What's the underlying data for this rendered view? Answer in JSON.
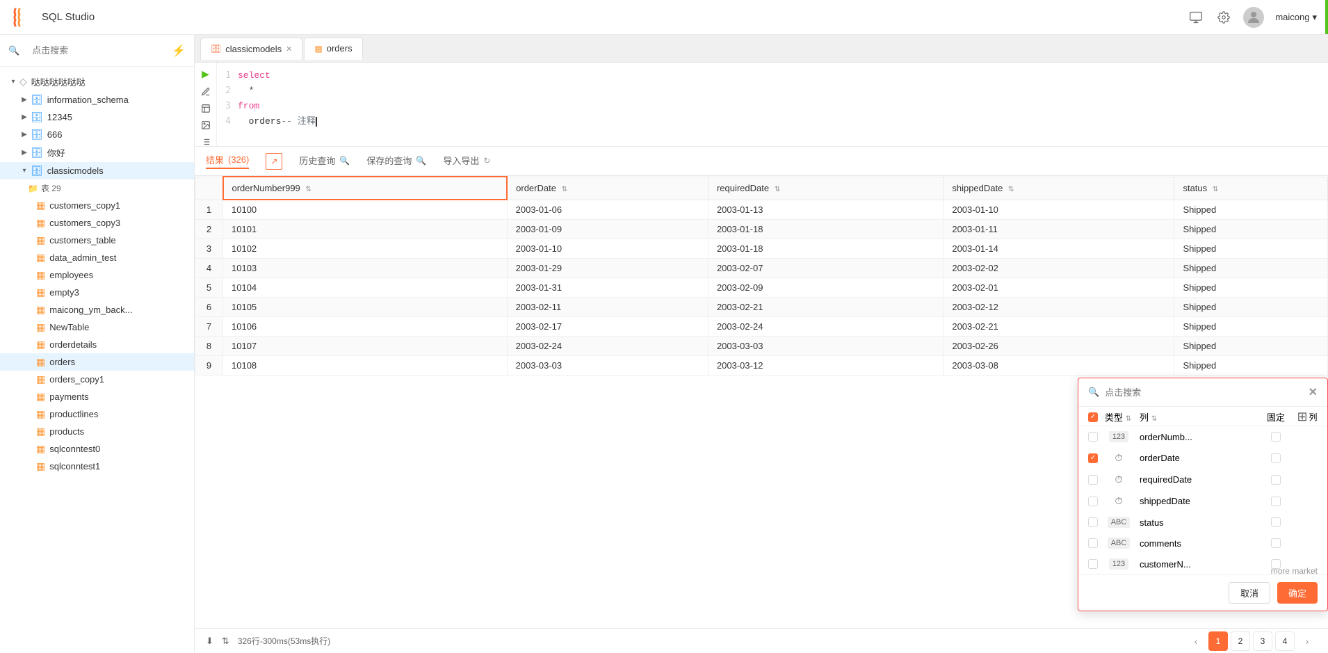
{
  "app": {
    "title": "SQL Studio",
    "username": "maicong"
  },
  "sidebar": {
    "search_placeholder": "点击搜索",
    "root_label": "哒哒哒哒哒哒",
    "databases": [
      {
        "name": "information_schema"
      },
      {
        "name": "12345"
      },
      {
        "name": "666"
      },
      {
        "name": "你好"
      },
      {
        "name": "classicmodels",
        "expanded": true
      }
    ],
    "table_group": "表 29",
    "tables": [
      "customers_copy1",
      "customers_copy3",
      "customers_table",
      "data_admin_test",
      "employees",
      "empty3",
      "maicong_ym_back...",
      "NewTable",
      "orderdetails",
      "orders",
      "orders_copy1",
      "payments",
      "productlines",
      "products",
      "sqlconntest0",
      "sqlconntest1"
    ]
  },
  "tabs": [
    {
      "label": "classicmodels",
      "type": "db",
      "closable": true
    },
    {
      "label": "orders",
      "type": "table",
      "closable": false,
      "active": true
    }
  ],
  "editor": {
    "lines": [
      {
        "num": 1,
        "code": "select",
        "type": "keyword"
      },
      {
        "num": 2,
        "code": "*",
        "type": "normal"
      },
      {
        "num": 3,
        "code": "from",
        "type": "keyword"
      },
      {
        "num": 4,
        "code": "orders -- 注释",
        "type": "mixed"
      }
    ]
  },
  "result_tabs": [
    {
      "label": "结果",
      "count": "(326)",
      "active": true
    },
    {
      "label": "历史查询",
      "active": false
    },
    {
      "label": "保存的查询",
      "active": false
    },
    {
      "label": "导入导出",
      "active": false
    }
  ],
  "table": {
    "columns": [
      {
        "name": "orderNumber999",
        "highlighted": true
      },
      {
        "name": "orderDate"
      },
      {
        "name": "requiredDate"
      },
      {
        "name": "shippedDate"
      },
      {
        "name": "status"
      }
    ],
    "rows": [
      {
        "num": 1,
        "orderNumber": "10100",
        "orderDate": "2003-01-06",
        "requiredDate": "2003-01-13",
        "shippedDate": "2003-01-10",
        "status": "Shipped"
      },
      {
        "num": 2,
        "orderNumber": "10101",
        "orderDate": "2003-01-09",
        "requiredDate": "2003-01-18",
        "shippedDate": "2003-01-11",
        "status": "Shipped"
      },
      {
        "num": 3,
        "orderNumber": "10102",
        "orderDate": "2003-01-10",
        "requiredDate": "2003-01-18",
        "shippedDate": "2003-01-14",
        "status": "Shipped"
      },
      {
        "num": 4,
        "orderNumber": "10103",
        "orderDate": "2003-01-29",
        "requiredDate": "2003-02-07",
        "shippedDate": "2003-02-02",
        "status": "Shipped"
      },
      {
        "num": 5,
        "orderNumber": "10104",
        "orderDate": "2003-01-31",
        "requiredDate": "2003-02-09",
        "shippedDate": "2003-02-01",
        "status": "Shipped"
      },
      {
        "num": 6,
        "orderNumber": "10105",
        "orderDate": "2003-02-11",
        "requiredDate": "2003-02-21",
        "shippedDate": "2003-02-12",
        "status": "Shipped"
      },
      {
        "num": 7,
        "orderNumber": "10106",
        "orderDate": "2003-02-17",
        "requiredDate": "2003-02-24",
        "shippedDate": "2003-02-21",
        "status": "Shipped"
      },
      {
        "num": 8,
        "orderNumber": "10107",
        "orderDate": "2003-02-24",
        "requiredDate": "2003-03-03",
        "shippedDate": "2003-02-26",
        "status": "Shipped"
      },
      {
        "num": 9,
        "orderNumber": "10108",
        "orderDate": "2003-03-03",
        "requiredDate": "2003-03-12",
        "shippedDate": "2003-03-08",
        "status": "Shipped"
      }
    ]
  },
  "bottom": {
    "download_icon": "⬇",
    "sort_icon": "⇅",
    "stats": "326行-300ms(53ms执行)",
    "pages": [
      "1",
      "2",
      "3",
      "4"
    ]
  },
  "column_selector": {
    "search_placeholder": "点击搜索",
    "close_label": "✕",
    "header_labels": {
      "type": "类型",
      "column": "列",
      "pin": "固定",
      "toggle": "列"
    },
    "columns": [
      {
        "type": "123",
        "name": "orderNumb...",
        "checked": false,
        "pinned": false
      },
      {
        "type": "clock",
        "name": "orderDate",
        "checked": true,
        "pinned": false
      },
      {
        "type": "clock",
        "name": "requiredDate",
        "checked": false,
        "pinned": false
      },
      {
        "type": "clock",
        "name": "shippedDate",
        "checked": false,
        "pinned": false
      },
      {
        "type": "ABC",
        "name": "status",
        "checked": false,
        "pinned": false
      },
      {
        "type": "ABC",
        "name": "comments",
        "checked": false,
        "pinned": false
      },
      {
        "type": "123",
        "name": "customerN...",
        "checked": false,
        "pinned": false
      }
    ],
    "more_market": "more market",
    "cancel_label": "取消",
    "confirm_label": "确定"
  }
}
